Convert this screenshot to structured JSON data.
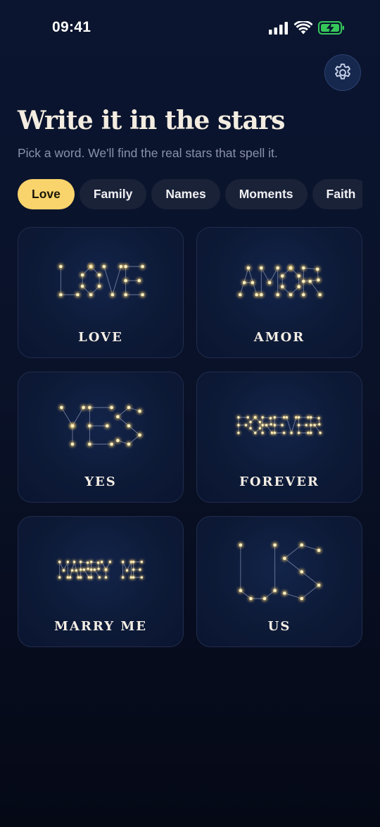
{
  "status_bar": {
    "time": "09:41"
  },
  "header": {
    "title": "Write it in the stars",
    "subtitle": "Pick a word. We'll find the real stars that spell it."
  },
  "categories": [
    {
      "label": "Love",
      "active": true
    },
    {
      "label": "Family",
      "active": false
    },
    {
      "label": "Names",
      "active": false
    },
    {
      "label": "Moments",
      "active": false
    },
    {
      "label": "Faith",
      "active": false
    }
  ],
  "cards": [
    {
      "label": "LOVE"
    },
    {
      "label": "AMOR"
    },
    {
      "label": "YES"
    },
    {
      "label": "FOREVER"
    },
    {
      "label": "MARRY ME"
    },
    {
      "label": "US"
    }
  ],
  "icons": {
    "settings": "gear-icon",
    "signal": "signal-icon",
    "wifi": "wifi-icon",
    "battery": "battery-charging-icon"
  },
  "colors": {
    "accent": "#f9d46c",
    "star": "#ffe39a",
    "battery": "#35c759"
  }
}
